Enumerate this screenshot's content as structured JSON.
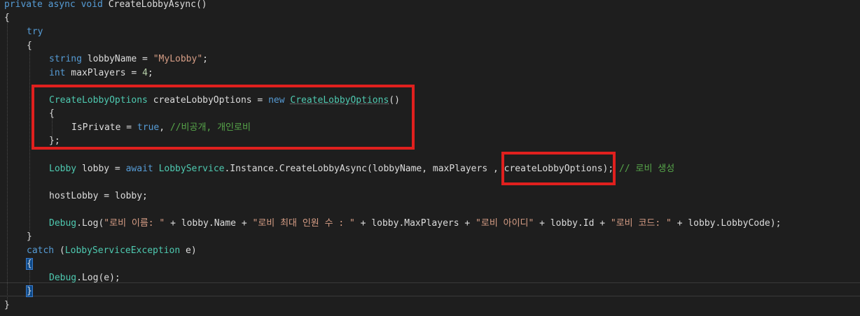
{
  "code": {
    "l1": {
      "kw": "private async void ",
      "name": "CreateLobbyAsync",
      "rest": "()"
    },
    "l2": {
      "text": "{"
    },
    "l3": {
      "kw": "try"
    },
    "l4": {
      "text": "{"
    },
    "l5": {
      "type": "string",
      "ident": " lobbyName = ",
      "str": "\"MyLobby\"",
      "end": ";"
    },
    "l6": {
      "type": "int",
      "ident": " maxPlayers = ",
      "num": "4",
      "end": ";"
    },
    "l7": {
      "type": "CreateLobbyOptions",
      "ident": " createLobbyOptions = ",
      "kw": "new ",
      "ctor": "CreateLobbyOptions",
      "end": "()"
    },
    "l8": {
      "text": "{"
    },
    "l9": {
      "ident": "IsPrivate = ",
      "kw": "true",
      "sep": ", ",
      "comment": "//비공개, 개인로비"
    },
    "l10": {
      "text": "};"
    },
    "l11": {
      "type": "Lobby",
      "ident": " lobby = ",
      "kw": "await ",
      "svc": "LobbyService",
      "call": ".Instance.CreateLobbyAsync(lobbyName, maxPlayers , createLobbyOptions);",
      "comment": " // 로비 생성"
    },
    "l12": {
      "text": "hostLobby = lobby;"
    },
    "l13": {
      "type": "Debug",
      "call": ".Log(",
      "s1": "\"로비 이름: \"",
      "p1": " + lobby.Name + ",
      "s2": "\"로비 최대 인원 수 : \"",
      "p2": " + lobby.MaxPlayers + ",
      "s3": "\"로비 아이디\"",
      "p3": " + lobby.Id + ",
      "s4": "\"로비 코드: \"",
      "p4": " + lobby.LobbyCode);"
    },
    "l14": {
      "text": "}"
    },
    "l15": {
      "kw": "catch",
      "sp": " (",
      "type": "LobbyServiceException",
      "end": " e)"
    },
    "l16": {
      "text": "{"
    },
    "l17": {
      "type": "Debug",
      "call": ".Log(e);"
    },
    "l18": {
      "text": "}"
    },
    "l19": {
      "text": "}"
    }
  },
  "colors": {
    "background": "#1e1e1e",
    "keyword": "#569cd6",
    "type": "#4ec9b0",
    "string": "#d69d85",
    "comment": "#57a64a",
    "highlight_box": "#e0201e"
  }
}
